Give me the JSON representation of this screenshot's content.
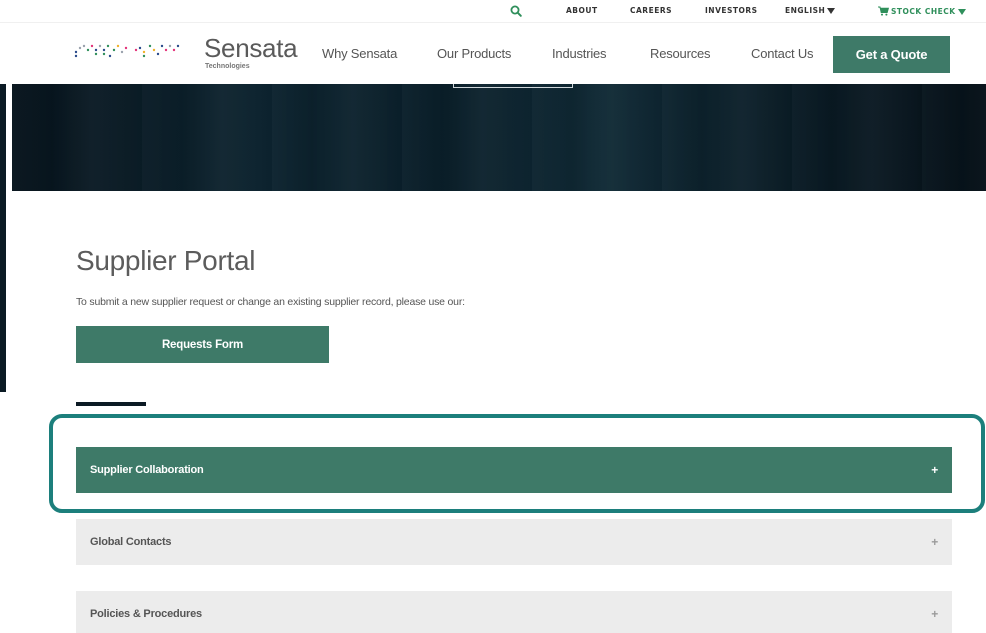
{
  "utility_bar": {
    "about": "ABOUT",
    "careers": "CAREERS",
    "investors": "INVESTORS",
    "language": "ENGLISH",
    "stock_check": "STOCK CHECK"
  },
  "brand": {
    "name": "Sensata",
    "sub": "Technologies"
  },
  "nav": {
    "items": [
      "Why Sensata",
      "Our Products",
      "Industries",
      "Resources",
      "Contact Us"
    ],
    "cta": "Get a Quote"
  },
  "content": {
    "title": "Supplier Portal",
    "intro": "To submit a new supplier request or change an existing supplier record, please use our:",
    "request_button": "Requests Form"
  },
  "accordion": [
    {
      "label": "Supplier Collaboration",
      "toggle": "+"
    },
    {
      "label": "Global Contacts",
      "toggle": "+"
    },
    {
      "label": "Policies & Procedures",
      "toggle": "+"
    }
  ],
  "colors": {
    "accent": "#3e7a68",
    "highlight": "#1c7f7c",
    "stock": "#2f8f5b",
    "hero": "#0d2430"
  }
}
